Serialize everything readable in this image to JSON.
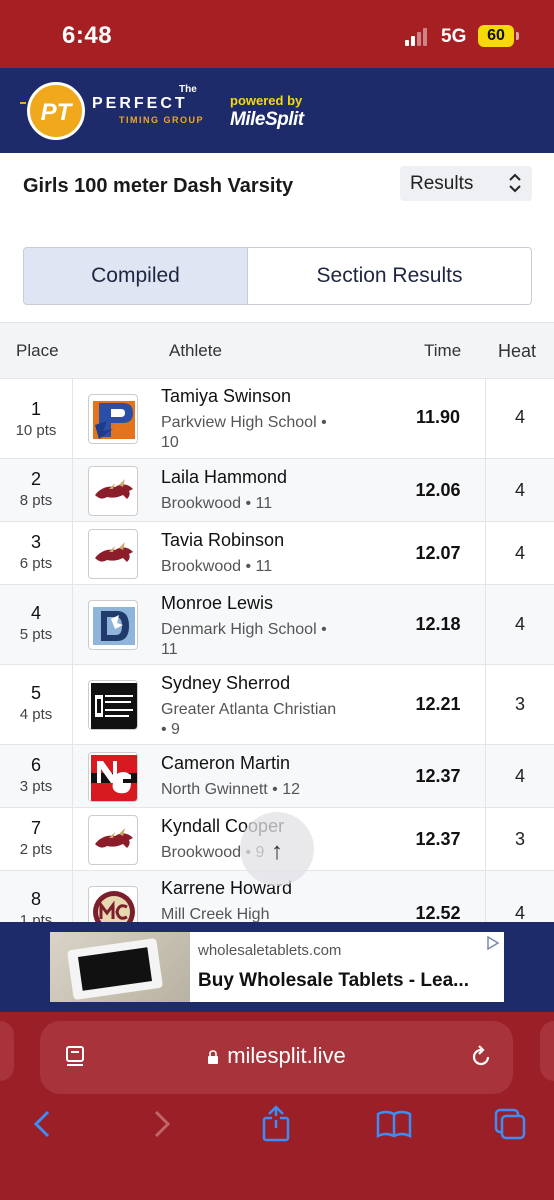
{
  "status_bar": {
    "time": "6:48",
    "network": "5G",
    "battery": "60"
  },
  "header": {
    "logo_initials": "PT",
    "logo_the": "The",
    "logo_name": "PERFECT",
    "logo_sub": "TIMING GROUP",
    "powered_by": "powered by",
    "milesplit": "MileSplit"
  },
  "event": {
    "title": "Girls 100 meter Dash Varsity",
    "view_select": "Results"
  },
  "tabs": {
    "compiled": "Compiled",
    "section_results": "Section Results"
  },
  "table": {
    "headers": {
      "place": "Place",
      "athlete": "Athlete",
      "time": "Time",
      "heat": "Heat"
    },
    "rows": [
      {
        "place": "1",
        "points": "10 pts",
        "name": "Tamiya Swinson",
        "school": "Parkview High School • 10",
        "time": "11.90",
        "heat": "4",
        "logo_icon": "parkview-logo-icon"
      },
      {
        "place": "2",
        "points": "8 pts",
        "name": "Laila Hammond",
        "school": "Brookwood • 11",
        "time": "12.06",
        "heat": "4",
        "logo_icon": "brookwood-logo-icon"
      },
      {
        "place": "3",
        "points": "6 pts",
        "name": "Tavia Robinson",
        "school": "Brookwood • 11",
        "time": "12.07",
        "heat": "4",
        "logo_icon": "brookwood-logo-icon"
      },
      {
        "place": "4",
        "points": "5 pts",
        "name": "Monroe Lewis",
        "school": "Denmark High School • 11",
        "time": "12.18",
        "heat": "4",
        "logo_icon": "denmark-logo-icon"
      },
      {
        "place": "5",
        "points": "4 pts",
        "name": "Sydney Sherrod",
        "school": "Greater Atlanta Christian • 9",
        "time": "12.21",
        "heat": "3",
        "logo_icon": "gac-logo-icon"
      },
      {
        "place": "6",
        "points": "3 pts",
        "name": "Cameron Martin",
        "school": "North Gwinnett • 12",
        "time": "12.37",
        "heat": "4",
        "logo_icon": "north-gwinnett-logo-icon"
      },
      {
        "place": "7",
        "points": "2 pts",
        "name": "Kyndall Cooper",
        "school": "Brookwood • 9",
        "time": "12.37",
        "heat": "3",
        "logo_icon": "brookwood-logo-icon"
      },
      {
        "place": "8",
        "points": "1 pts",
        "name": "Karrene Howard",
        "school": "Mill Creek High",
        "time": "12.52",
        "heat": "4",
        "logo_icon": "mill-creek-logo-icon"
      }
    ]
  },
  "ad": {
    "domain": "wholesaletablets.com",
    "headline": "Buy Wholesale Tablets - Lea..."
  },
  "browser": {
    "url": "milesplit.live"
  },
  "colors": {
    "status_red": "#a61f23",
    "header_navy": "#1d2b6b",
    "browser_red": "#9a1f26"
  }
}
